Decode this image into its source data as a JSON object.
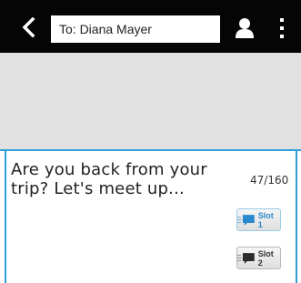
{
  "header": {
    "recipient_value": "To: Diana Mayer"
  },
  "compose": {
    "message_text": "Are you back from your trip? Let's meet up...",
    "char_counter": "47/160",
    "slot1_label": "Slot 1",
    "slot2_label": "Slot 2"
  },
  "icons": {
    "back": "back-arrow-icon",
    "contact": "person-icon",
    "menu": "more-vert-icon",
    "slot": "speech-bubble-icon"
  },
  "colors": {
    "topbar": "#050505",
    "empty_area": "#e1e1e1",
    "accent": "#2f9fd8",
    "slot_active_text": "#2a8ad0",
    "slot_text": "#333333"
  }
}
